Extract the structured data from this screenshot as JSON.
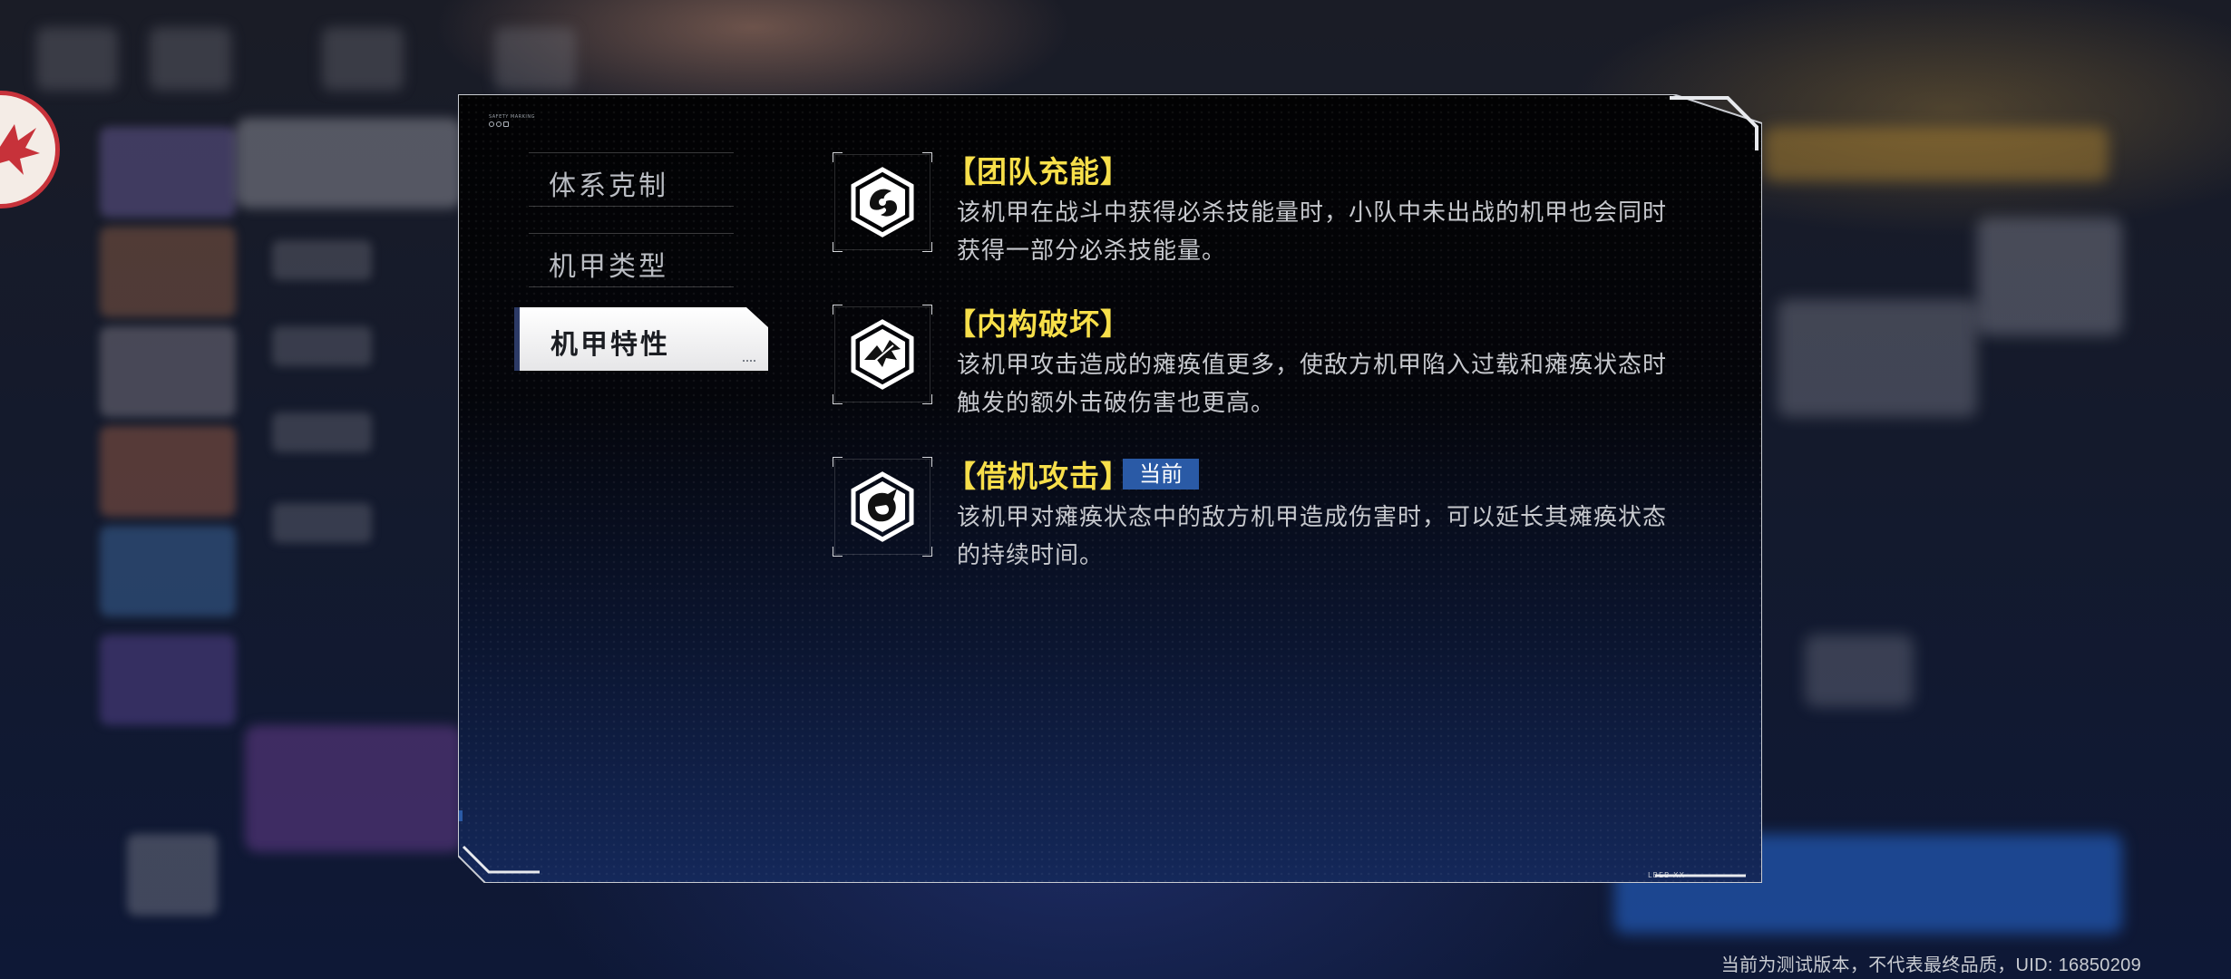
{
  "dialog": {
    "tag_text": "SAFETY MARKING",
    "tabs": [
      {
        "label": "体系克制",
        "active": false
      },
      {
        "label": "机甲类型",
        "active": false
      },
      {
        "label": "机甲特性",
        "active": true
      }
    ],
    "features": [
      {
        "title": "【团队充能】",
        "icon": "team-charge-icon",
        "description": "该机甲在战斗中获得必杀技能量时，小队中未出战的机甲也会同时获得一部分必杀技能量。",
        "badge": null
      },
      {
        "title": "【内构破坏】",
        "icon": "internal-break-icon",
        "description": "该机甲攻击造成的瘫痪值更多，使敌方机甲陷入过载和瘫痪状态时触发的额外击破伤害也更高。",
        "badge": null
      },
      {
        "title": "【借机攻击】",
        "icon": "opportunity-attack-icon",
        "description": "该机甲对瘫痪状态中的敌方机甲造成伤害时，可以延长其瘫痪状态的持续时间。",
        "badge": "当前"
      }
    ],
    "corner_label": "LBEB XX"
  },
  "footer": {
    "version_note": "当前为测试版本，不代表最终品质，UID: 16850209"
  },
  "colors": {
    "title_yellow": "#f7df4a",
    "badge_blue": "#2a5aa6",
    "emblem_red": "#c7323a"
  }
}
